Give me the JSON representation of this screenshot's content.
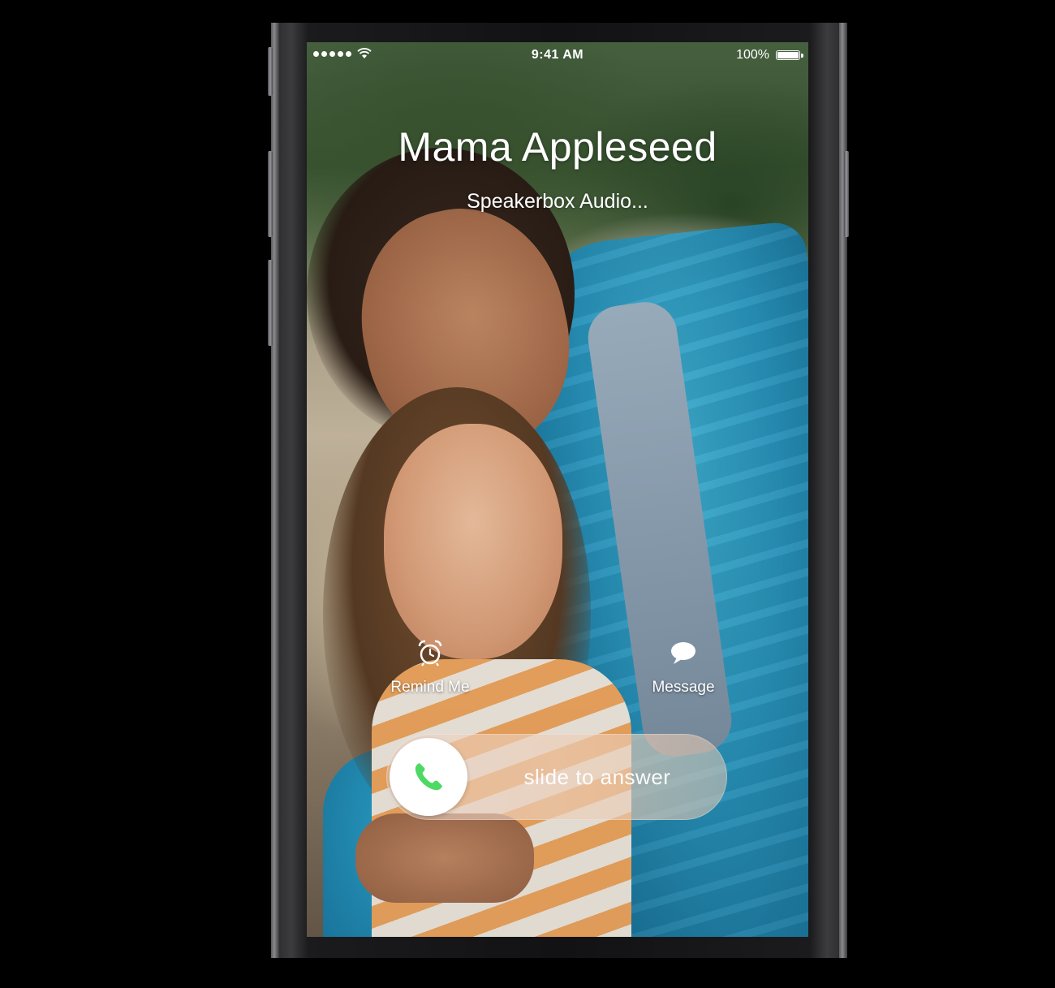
{
  "status_bar": {
    "signal_icon": "signal-dots-icon",
    "wifi_icon": "wifi-icon",
    "time": "9:41 AM",
    "battery_percent": "100%",
    "battery_icon": "battery-icon"
  },
  "call": {
    "caller_name": "Mama Appleseed",
    "app_label": "Speakerbox Audio..."
  },
  "actions": {
    "remind": {
      "label": "Remind Me",
      "icon": "alarm-clock-icon"
    },
    "message": {
      "label": "Message",
      "icon": "speech-bubble-icon"
    }
  },
  "slider": {
    "label": "slide to answer",
    "knob_icon": "phone-icon",
    "accent_color": "#4cd964"
  }
}
